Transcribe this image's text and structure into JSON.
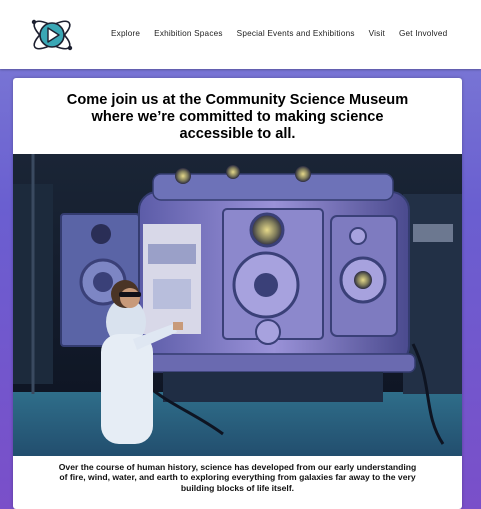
{
  "brand": {
    "logo_icon": "atom-play-icon",
    "colors": {
      "teal": "#3aa7b5",
      "dark": "#1d2030",
      "purple": "#6a5fd0"
    }
  },
  "nav": {
    "items": [
      {
        "label": "Explore"
      },
      {
        "label": "Exhibition Spaces"
      },
      {
        "label": "Special Events and Exhibitions"
      },
      {
        "label": "Visit"
      },
      {
        "label": "Get Involved"
      }
    ]
  },
  "main": {
    "headline": "Come join us at the Community Science Museum where we’re committed to making science accessible to all.",
    "hero_image": "scientist-with-vacuum-chamber-photo",
    "body": "Over the course of human history, science has developed from our early understanding of fire, wind, water, and earth to exploring everything from galaxies far away to the very building blocks of life itself."
  }
}
